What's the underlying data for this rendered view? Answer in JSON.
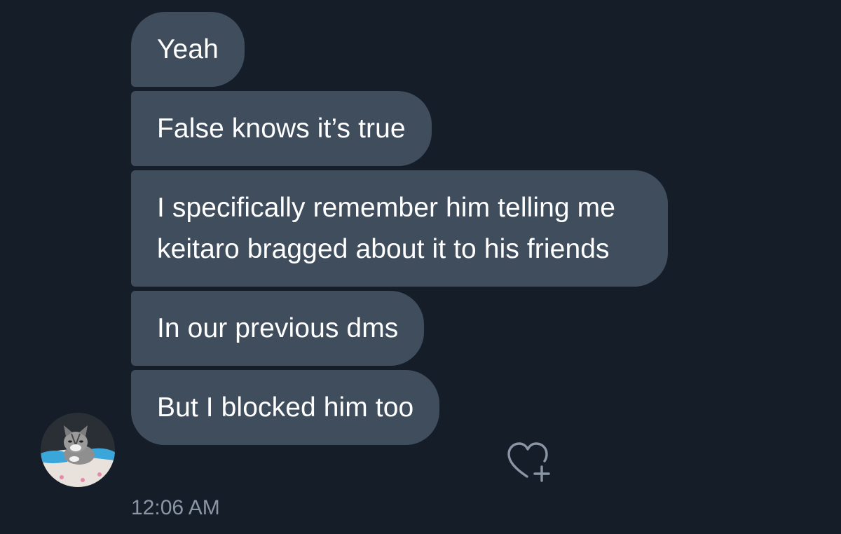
{
  "conversation": {
    "messages": [
      {
        "text": "Yeah"
      },
      {
        "text": "False knows it’s true"
      },
      {
        "text": "I specifically remember him telling me keitaro bragged about it to his friends"
      },
      {
        "text": "In our previous dms"
      },
      {
        "text": "But I blocked him too"
      }
    ],
    "timestamp": "12:06 AM"
  },
  "icons": {
    "reaction": "heart-plus-icon",
    "avatar": "cat-avatar"
  },
  "colors": {
    "background": "#151d29",
    "bubble": "#3f4d5d",
    "text": "#ffffff",
    "muted": "#8a96a5"
  }
}
